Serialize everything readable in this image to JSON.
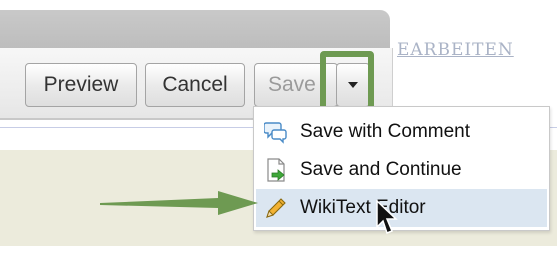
{
  "header": {
    "partial_tab_text": "EARBEITEN"
  },
  "toolbar": {
    "preview_label": "Preview",
    "cancel_label": "Cancel",
    "save_label": "Save"
  },
  "save_menu": {
    "items": [
      {
        "label": "Save with Comment",
        "icon": "speech-bubbles-icon"
      },
      {
        "label": "Save and Continue",
        "icon": "document-arrow-icon"
      },
      {
        "label": "WikiText Editor",
        "icon": "pencil-icon",
        "hovered": true
      }
    ]
  },
  "colors": {
    "highlight": "#6e9a52",
    "menu_hover": "#dbe6f1",
    "content_band": "#ecebdc"
  }
}
